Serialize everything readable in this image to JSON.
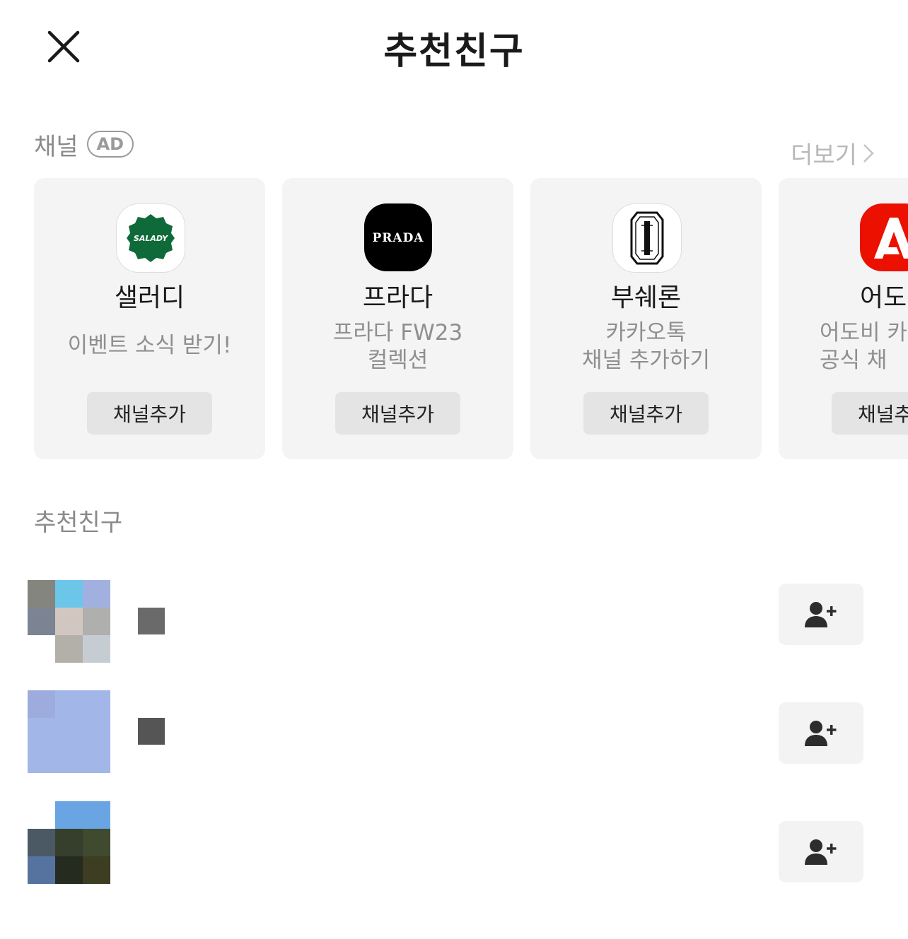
{
  "header": {
    "title": "추천친구"
  },
  "channels": {
    "label": "채널",
    "badge": "AD",
    "more": "더보기",
    "add_label": "채널추가",
    "items": [
      {
        "name": "샐러디",
        "desc": "이벤트 소식 받기!",
        "logo_text": "SALADY",
        "logo_color": "#0f6a3a"
      },
      {
        "name": "프라다",
        "desc": "프라다 FW23\n컬렉션",
        "logo_text": "PRADA",
        "logo_color": "#000000"
      },
      {
        "name": "부쉐론",
        "desc": "카카오톡\n채널 추가하기",
        "logo_text": "",
        "logo_color": "#ffffff"
      },
      {
        "name": "어도비",
        "desc": "어도비 카\n공식 채",
        "logo_text": "",
        "logo_color": "#eb1000"
      }
    ]
  },
  "friends": {
    "section_title": "추천친구",
    "items": [
      {
        "avatar_colors": [
          "#858580",
          "#6bc6ea",
          "#a2b0e0",
          "#7c8494",
          "#d2c7c0",
          "#afafad",
          "#ffffff",
          "#b2b0a8",
          "#c5cdd2"
        ],
        "name_color": "#6a6a6a"
      },
      {
        "avatar_colors": [
          "#9dacdc",
          "#a2b6e8",
          "#a2b6e8",
          "#a2b6e8",
          "#a2b6e8",
          "#a2b6e8",
          "#a2b6e8",
          "#a2b6e8",
          "#a2b6e8"
        ],
        "name_color": "#555555"
      },
      {
        "avatar_colors": [
          "#ffffff",
          "#6aa5e3",
          "#6aa5e3",
          "#4b5964",
          "#353f2c",
          "#3f4a2e",
          "#56729f",
          "#252b1f",
          "#3c3d21"
        ],
        "name_color": "#ffffff"
      }
    ]
  }
}
